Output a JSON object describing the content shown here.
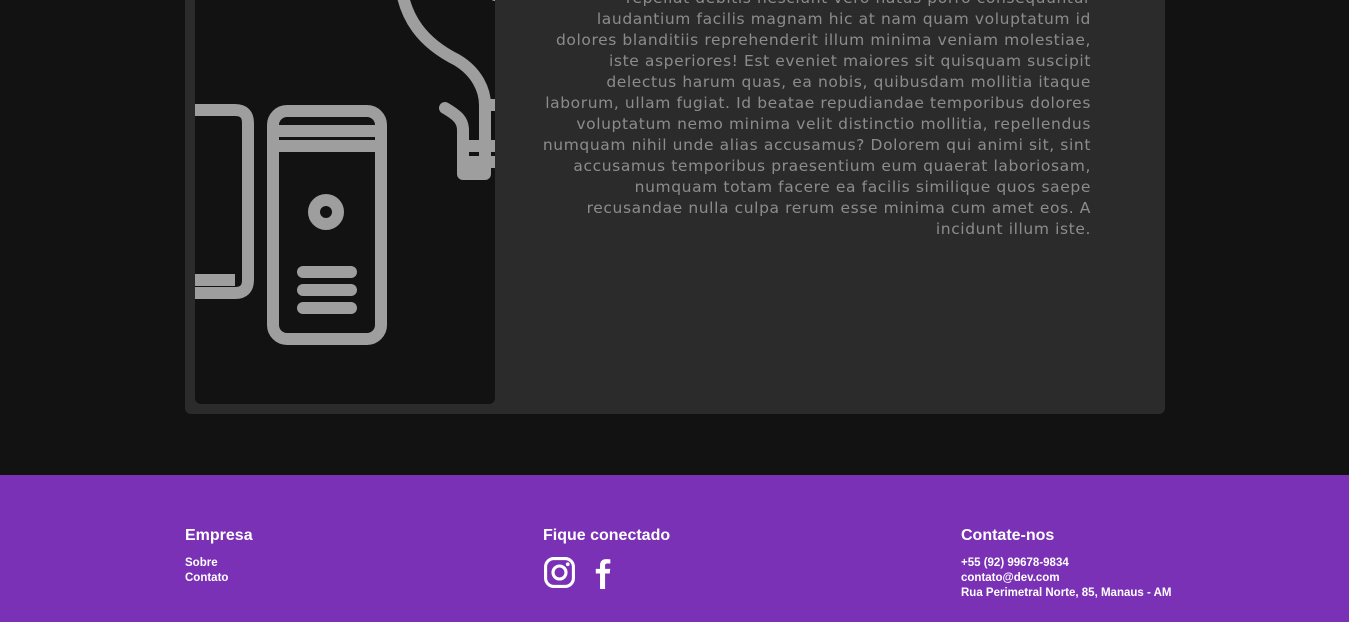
{
  "main": {
    "description": "repellat debitis nesciunt vero natus porro consequuntur laudantium facilis magnam hic at nam quam voluptatum id dolores blanditiis reprehenderit illum minima veniam molestiae, iste asperiores! Est eveniet maiores sit quisquam suscipit delectus harum quas, ea nobis, quibusdam mollitia itaque laborum, ullam fugiat. Id beatae repudiandae temporibus dolores voluptatum nemo minima velit distinctio mollitia, repellendus numquam nihil unde alias accusamus? Dolorem qui animi sit, sint accusamus temporibus praesentium eum quaerat laboriosam, numquam totam facere ea facilis similique quos saepe recusandae nulla culpa rerum esse minima cum amet eos. A incidunt illum iste.",
    "image_icons": [
      "computer-tower-icon",
      "lightbulb-icon"
    ]
  },
  "footer": {
    "empresa": {
      "title": "Empresa",
      "links": [
        "Sobre",
        "Contato"
      ]
    },
    "social": {
      "title": "Fique conectado",
      "icons": [
        "instagram-icon",
        "facebook-icon"
      ]
    },
    "contato": {
      "title": "Contate-nos",
      "phone": "+55 (92) 99678-9834",
      "email": "contato@dev.com",
      "address": "Rua Perimetral Norte, 85, Manaus - AM"
    }
  },
  "colors": {
    "page_bg": "#121212",
    "card_bg": "#2b2b2b",
    "icon_stroke": "#9e9e9e",
    "text_muted": "#8c8c8c",
    "footer_bg": "#7b31b5",
    "footer_text": "#ffffff"
  }
}
